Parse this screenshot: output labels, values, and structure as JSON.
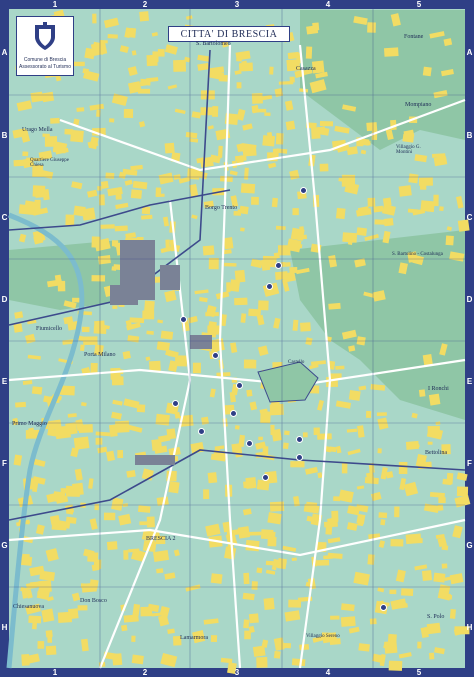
{
  "title": "CITTA' DI BRESCIA",
  "logo": {
    "line1": "Comune di Brescia",
    "line2": "Assessorato al Turismo"
  },
  "grid": {
    "columns": [
      "1",
      "2",
      "3",
      "4",
      "5"
    ],
    "rows": [
      "A",
      "B",
      "C",
      "D",
      "E",
      "F",
      "G",
      "H"
    ]
  },
  "colors": {
    "frame": "#2f3f86",
    "block": "#f2dc63",
    "street": "#a9d7c8",
    "park": "#8fc6a6",
    "river": "#9fd0de",
    "rail": "#3d4a8c"
  },
  "places": [
    {
      "name": "S. Bartolomeo"
    },
    {
      "name": "Casazza"
    },
    {
      "name": "Fontane"
    },
    {
      "name": "Mompiano"
    },
    {
      "name": "Urago Mella"
    },
    {
      "name": "Quartiere Giuseppe Chiesa"
    },
    {
      "name": "Borgo Trento"
    },
    {
      "name": "Villaggio G. Montini"
    },
    {
      "name": "S. Bartolino - Costalunga"
    },
    {
      "name": "Fiumicello"
    },
    {
      "name": "Porta Milano"
    },
    {
      "name": "Castello"
    },
    {
      "name": "I Ronchi"
    },
    {
      "name": "Primo Maggio"
    },
    {
      "name": "Bettolina"
    },
    {
      "name": "BRESCIA 2"
    },
    {
      "name": "Chiesanuova"
    },
    {
      "name": "Don Bosco"
    },
    {
      "name": "Lamarmora"
    },
    {
      "name": "Villaggio Sereno"
    },
    {
      "name": "S. Polo"
    }
  ],
  "pins": 14
}
